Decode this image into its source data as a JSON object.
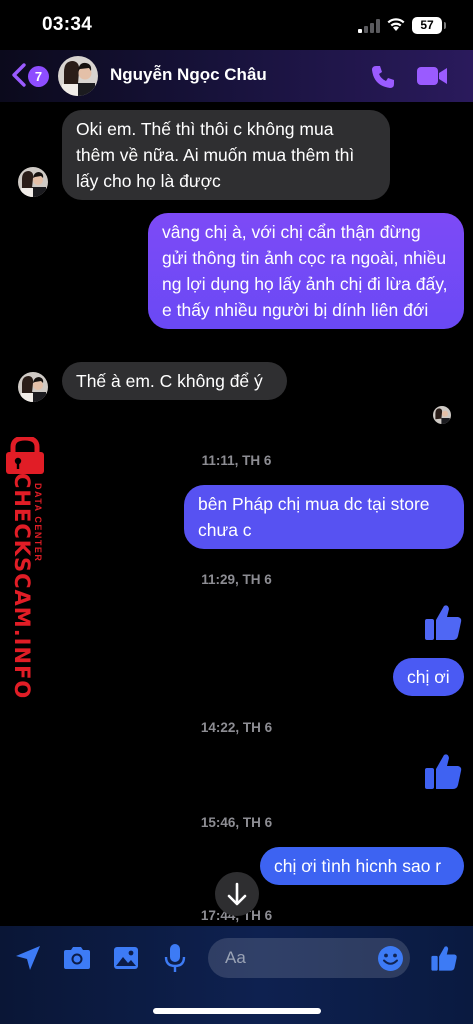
{
  "status": {
    "time": "03:34",
    "battery": "57"
  },
  "header": {
    "unread_count": "7",
    "contact_name": "Nguyễn Ngọc Châu"
  },
  "messages": [
    {
      "from": "them",
      "text": "Oki em. Thế thì thôi c không mua thêm về nữa. Ai muốn mua thêm thì lấy cho họ là được"
    },
    {
      "from": "me",
      "text": "vâng chị à, với chị cẩn thận đừng gửi thông tin ảnh cọc ra ngoài, nhiều ng lợi dụng họ lấy ảnh chị đi lừa đấy, e thấy nhiều người bị dính liên đới"
    },
    {
      "from": "them",
      "text": "Thế à em. C không để ý"
    },
    {
      "from": "me",
      "text": "bên Pháp chị mua dc tại store chưa c"
    },
    {
      "from": "me",
      "text": "chị ơi"
    },
    {
      "from": "me",
      "text": "chị ơi tình hicnh sao r"
    }
  ],
  "timestamps": [
    "11:11, TH 6",
    "11:29, TH 6",
    "14:22, TH 6",
    "15:46, TH 6",
    "17:44, TH 6"
  ],
  "watermark": {
    "brand": "CHECKSCAM.INFO",
    "tagline": "DATA CENTER"
  },
  "composer": {
    "placeholder": "Aa"
  },
  "icons": [
    "back-chevron-icon",
    "phone-icon",
    "video-camera-icon",
    "thumbs-up-icon",
    "arrow-down-icon",
    "location-arrow-icon",
    "camera-icon",
    "gallery-icon",
    "microphone-icon",
    "emoji-icon",
    "lock-icon"
  ],
  "colors": {
    "bubble_in": "#2f2f31",
    "accent_purple": "#8e4dff",
    "watermark_red": "#e11d26",
    "thumb_blue": "#3d6ef2"
  }
}
